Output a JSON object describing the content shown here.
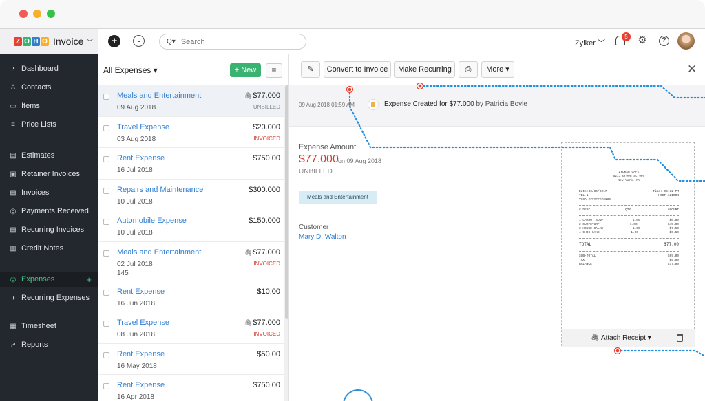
{
  "window": {
    "controls": [
      "close",
      "minimize",
      "maximize"
    ]
  },
  "topnav": {
    "brand_letters": [
      "Z",
      "O",
      "H",
      "O"
    ],
    "brand_colors": [
      "#e8402f",
      "#3ab272",
      "#2f7fd3",
      "#f5b12e"
    ],
    "app_name": "Invoice",
    "search_placeholder": "Search",
    "org_name": "Zylker",
    "notification_count": "5"
  },
  "sidebar": {
    "items": [
      {
        "label": "Dashboard",
        "icon": "dashboard-icon",
        "glyph": "◔"
      },
      {
        "label": "Contacts",
        "icon": "contacts-icon",
        "glyph": "♙"
      },
      {
        "label": "Items",
        "icon": "items-icon",
        "glyph": "▭"
      },
      {
        "label": "Price Lists",
        "icon": "price-lists-icon",
        "glyph": "≡"
      },
      {
        "label": "Estimates",
        "icon": "estimates-icon",
        "glyph": "▤"
      },
      {
        "label": "Retainer Invoices",
        "icon": "retainer-invoices-icon",
        "glyph": "▣"
      },
      {
        "label": "Invoices",
        "icon": "invoices-icon",
        "glyph": "▤"
      },
      {
        "label": "Payments Received",
        "icon": "payments-icon",
        "glyph": "◎"
      },
      {
        "label": "Recurring Invoices",
        "icon": "recurring-invoices-icon",
        "glyph": "▤"
      },
      {
        "label": "Credit Notes",
        "icon": "credit-notes-icon",
        "glyph": "▥"
      },
      {
        "label": "Expenses",
        "icon": "expenses-icon",
        "glyph": "◎"
      },
      {
        "label": "Recurring Expenses",
        "icon": "recurring-expenses-icon",
        "glyph": "◑"
      },
      {
        "label": "Timesheet",
        "icon": "timesheet-icon",
        "glyph": "▦"
      },
      {
        "label": "Reports",
        "icon": "reports-icon",
        "glyph": "↗"
      }
    ],
    "expenses_add": "+"
  },
  "list": {
    "title": "All Expenses",
    "new_button": "+ New",
    "rows": [
      {
        "name": "Meals and Entertainment",
        "date": "09 Aug 2018",
        "amount": "$77.000",
        "status": "UNBILLED",
        "attachment": true
      },
      {
        "name": "Travel Expense",
        "date": "03 Aug 2018",
        "amount": "$20.000",
        "status": "INVOICED",
        "attachment": false
      },
      {
        "name": "Rent Expense",
        "date": "16 Jul 2018",
        "amount": "$750.00",
        "status": "",
        "attachment": false
      },
      {
        "name": "Repairs and Maintenance",
        "date": "10 Jul 2018",
        "amount": "$300.000",
        "status": "",
        "attachment": false
      },
      {
        "name": "Automobile Expense",
        "date": "10 Jul 2018",
        "amount": "$150.000",
        "status": "",
        "attachment": false
      },
      {
        "name": "Meals and Entertainment",
        "date": "02 Jul 2018",
        "ref": "145",
        "amount": "$77.000",
        "status": "INVOICED",
        "attachment": true
      },
      {
        "name": "Rent Expense",
        "date": "16 Jun 2018",
        "amount": "$10.00",
        "status": "",
        "attachment": false
      },
      {
        "name": "Travel Expense",
        "date": "08 Jun 2018",
        "amount": "$77.000",
        "status": "INVOICED",
        "attachment": true
      },
      {
        "name": "Rent Expense",
        "date": "16 May 2018",
        "amount": "$50.00",
        "status": "",
        "attachment": false
      },
      {
        "name": "Rent Expense",
        "date": "16 Apr 2018",
        "amount": "$750.00",
        "status": "",
        "attachment": false
      }
    ]
  },
  "detail": {
    "toolbar": {
      "convert": "Convert to Invoice",
      "recurring": "Make Recurring",
      "more": "More"
    },
    "history": {
      "timestamp": "09 Aug 2018 01:59 AM",
      "message": "Expense Created for $77.000",
      "by": "by Patricia Boyle"
    },
    "amount_label": "Expense Amount",
    "amount": "$77.000",
    "amount_date": "on 09 Aug 2018",
    "status": "UNBILLED",
    "category": "Meals and Entertainment",
    "customer_label": "Customer",
    "customer": "Mary D. Walton",
    "attach_label": "Attach Receipt",
    "receipt": {
      "header": [
        "ZYLKER CAFE",
        "5211 Green Street",
        "New York, NY"
      ],
      "meta": [
        [
          "Date:30/05/2017",
          "Time: 06:32 PM"
        ],
        [
          "TBL 1",
          "HOST ALISON"
        ],
        [
          "VISA ########3136",
          ""
        ]
      ],
      "columns": [
        "# DESC",
        "QTY.",
        "AMOUNT"
      ],
      "items": [
        [
          "1 CARROT SOUP",
          "1.00",
          "$6.00"
        ],
        [
          "2 SURFETURF",
          "1.00",
          "$49.00"
        ],
        [
          "3 HOUSE SALAD",
          "1.00",
          "$7.50"
        ],
        [
          "4 CHOC CAKE",
          "1.00",
          "$6.50"
        ]
      ],
      "total_label": "TOTAL",
      "total": "$77.00",
      "summary": [
        [
          "SUB-TOTAL",
          "$69.00"
        ],
        [
          "TAX",
          "$9.00"
        ],
        [
          "BALANCE",
          "$77.00"
        ]
      ]
    }
  },
  "accent_colors": {
    "green": "#3ab272",
    "red": "#d63b2f",
    "blue": "#2f7fd3",
    "sidebar": "#23272e",
    "annotation": "#1f8fe0"
  }
}
